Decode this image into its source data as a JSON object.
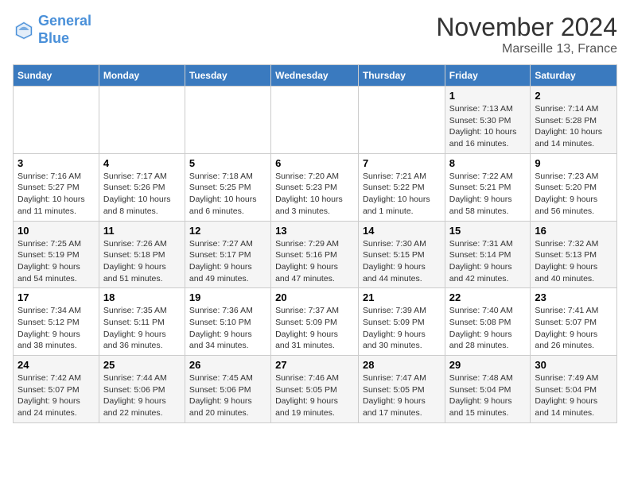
{
  "header": {
    "logo_line1": "General",
    "logo_line2": "Blue",
    "month": "November 2024",
    "location": "Marseille 13, France"
  },
  "columns": [
    "Sunday",
    "Monday",
    "Tuesday",
    "Wednesday",
    "Thursday",
    "Friday",
    "Saturday"
  ],
  "weeks": [
    [
      {
        "day": "",
        "info": ""
      },
      {
        "day": "",
        "info": ""
      },
      {
        "day": "",
        "info": ""
      },
      {
        "day": "",
        "info": ""
      },
      {
        "day": "",
        "info": ""
      },
      {
        "day": "1",
        "info": "Sunrise: 7:13 AM\nSunset: 5:30 PM\nDaylight: 10 hours\nand 16 minutes."
      },
      {
        "day": "2",
        "info": "Sunrise: 7:14 AM\nSunset: 5:28 PM\nDaylight: 10 hours\nand 14 minutes."
      }
    ],
    [
      {
        "day": "3",
        "info": "Sunrise: 7:16 AM\nSunset: 5:27 PM\nDaylight: 10 hours\nand 11 minutes."
      },
      {
        "day": "4",
        "info": "Sunrise: 7:17 AM\nSunset: 5:26 PM\nDaylight: 10 hours\nand 8 minutes."
      },
      {
        "day": "5",
        "info": "Sunrise: 7:18 AM\nSunset: 5:25 PM\nDaylight: 10 hours\nand 6 minutes."
      },
      {
        "day": "6",
        "info": "Sunrise: 7:20 AM\nSunset: 5:23 PM\nDaylight: 10 hours\nand 3 minutes."
      },
      {
        "day": "7",
        "info": "Sunrise: 7:21 AM\nSunset: 5:22 PM\nDaylight: 10 hours\nand 1 minute."
      },
      {
        "day": "8",
        "info": "Sunrise: 7:22 AM\nSunset: 5:21 PM\nDaylight: 9 hours\nand 58 minutes."
      },
      {
        "day": "9",
        "info": "Sunrise: 7:23 AM\nSunset: 5:20 PM\nDaylight: 9 hours\nand 56 minutes."
      }
    ],
    [
      {
        "day": "10",
        "info": "Sunrise: 7:25 AM\nSunset: 5:19 PM\nDaylight: 9 hours\nand 54 minutes."
      },
      {
        "day": "11",
        "info": "Sunrise: 7:26 AM\nSunset: 5:18 PM\nDaylight: 9 hours\nand 51 minutes."
      },
      {
        "day": "12",
        "info": "Sunrise: 7:27 AM\nSunset: 5:17 PM\nDaylight: 9 hours\nand 49 minutes."
      },
      {
        "day": "13",
        "info": "Sunrise: 7:29 AM\nSunset: 5:16 PM\nDaylight: 9 hours\nand 47 minutes."
      },
      {
        "day": "14",
        "info": "Sunrise: 7:30 AM\nSunset: 5:15 PM\nDaylight: 9 hours\nand 44 minutes."
      },
      {
        "day": "15",
        "info": "Sunrise: 7:31 AM\nSunset: 5:14 PM\nDaylight: 9 hours\nand 42 minutes."
      },
      {
        "day": "16",
        "info": "Sunrise: 7:32 AM\nSunset: 5:13 PM\nDaylight: 9 hours\nand 40 minutes."
      }
    ],
    [
      {
        "day": "17",
        "info": "Sunrise: 7:34 AM\nSunset: 5:12 PM\nDaylight: 9 hours\nand 38 minutes."
      },
      {
        "day": "18",
        "info": "Sunrise: 7:35 AM\nSunset: 5:11 PM\nDaylight: 9 hours\nand 36 minutes."
      },
      {
        "day": "19",
        "info": "Sunrise: 7:36 AM\nSunset: 5:10 PM\nDaylight: 9 hours\nand 34 minutes."
      },
      {
        "day": "20",
        "info": "Sunrise: 7:37 AM\nSunset: 5:09 PM\nDaylight: 9 hours\nand 31 minutes."
      },
      {
        "day": "21",
        "info": "Sunrise: 7:39 AM\nSunset: 5:09 PM\nDaylight: 9 hours\nand 30 minutes."
      },
      {
        "day": "22",
        "info": "Sunrise: 7:40 AM\nSunset: 5:08 PM\nDaylight: 9 hours\nand 28 minutes."
      },
      {
        "day": "23",
        "info": "Sunrise: 7:41 AM\nSunset: 5:07 PM\nDaylight: 9 hours\nand 26 minutes."
      }
    ],
    [
      {
        "day": "24",
        "info": "Sunrise: 7:42 AM\nSunset: 5:07 PM\nDaylight: 9 hours\nand 24 minutes."
      },
      {
        "day": "25",
        "info": "Sunrise: 7:44 AM\nSunset: 5:06 PM\nDaylight: 9 hours\nand 22 minutes."
      },
      {
        "day": "26",
        "info": "Sunrise: 7:45 AM\nSunset: 5:06 PM\nDaylight: 9 hours\nand 20 minutes."
      },
      {
        "day": "27",
        "info": "Sunrise: 7:46 AM\nSunset: 5:05 PM\nDaylight: 9 hours\nand 19 minutes."
      },
      {
        "day": "28",
        "info": "Sunrise: 7:47 AM\nSunset: 5:05 PM\nDaylight: 9 hours\nand 17 minutes."
      },
      {
        "day": "29",
        "info": "Sunrise: 7:48 AM\nSunset: 5:04 PM\nDaylight: 9 hours\nand 15 minutes."
      },
      {
        "day": "30",
        "info": "Sunrise: 7:49 AM\nSunset: 5:04 PM\nDaylight: 9 hours\nand 14 minutes."
      }
    ]
  ]
}
